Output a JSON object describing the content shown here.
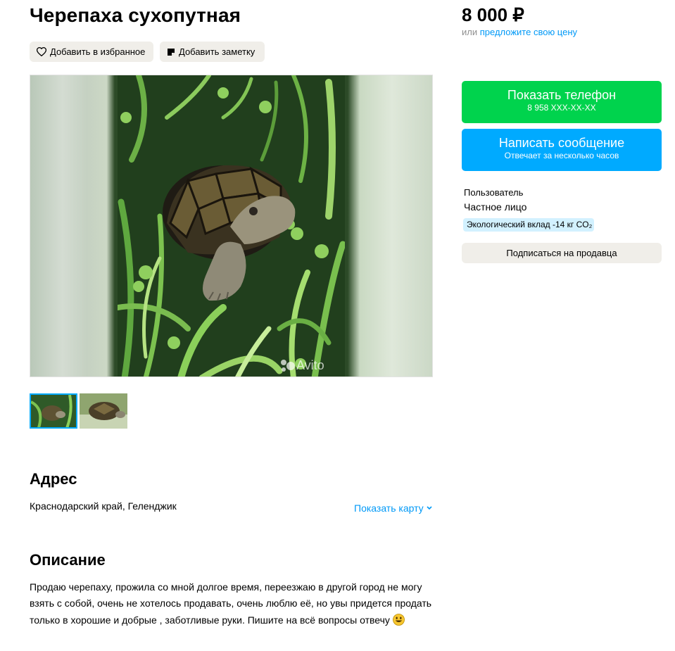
{
  "listing": {
    "title": "Черепаха сухопутная",
    "favorite_label": "Добавить в избранное",
    "note_label": "Добавить заметку",
    "watermark": "Avito"
  },
  "address": {
    "heading": "Адрес",
    "text": "Краснодарский край, Геленджик",
    "map_link": "Показать карту"
  },
  "description": {
    "heading": "Описание",
    "text": "Продаю черепаху, прожила со мной долгое время, переезжаю в другой город не могу взять с собой, очень не хотелось продавать, очень люблю её, но увы придется продать только в хорошие и добрые , заботливые руки. Пишите на всё вопросы отвечу"
  },
  "sidebar": {
    "price": "8 000 ₽",
    "offer_prefix": "или",
    "offer_link": "предложите свою цену",
    "phone_button": {
      "label": "Показать телефон",
      "sub": "8 958 XXX-XX-XX"
    },
    "message_button": {
      "label": "Написать сообщение",
      "sub": "Отвечает за несколько часов"
    },
    "seller_role": "Пользователь",
    "seller_type": "Частное лицо",
    "eco_badge": "Экологический вклад -14 кг CO₂",
    "subscribe_label": "Подписаться на продавца"
  },
  "colors": {
    "accent_blue": "#00aaff",
    "accent_green": "#00d34d",
    "link": "#0099f7",
    "chip_bg": "#f0eee9"
  }
}
